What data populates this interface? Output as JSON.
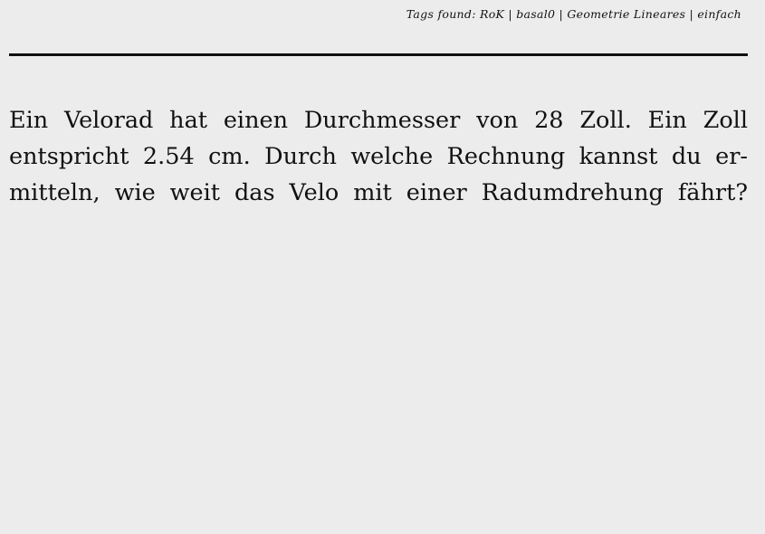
{
  "header": {
    "tags_line": "Tags found: RoK | basal0 | Geometrie Lineares | einfach"
  },
  "question": {
    "lines": [
      "Ein Velorad hat einen Durchmesser von 28 Zoll. Ein Zoll",
      "entspricht 2.54 cm. Durch welche Rechnung kannst du er-",
      "mitteln, wie weit das Velo mit einer Radumdrehung fährt?"
    ]
  }
}
